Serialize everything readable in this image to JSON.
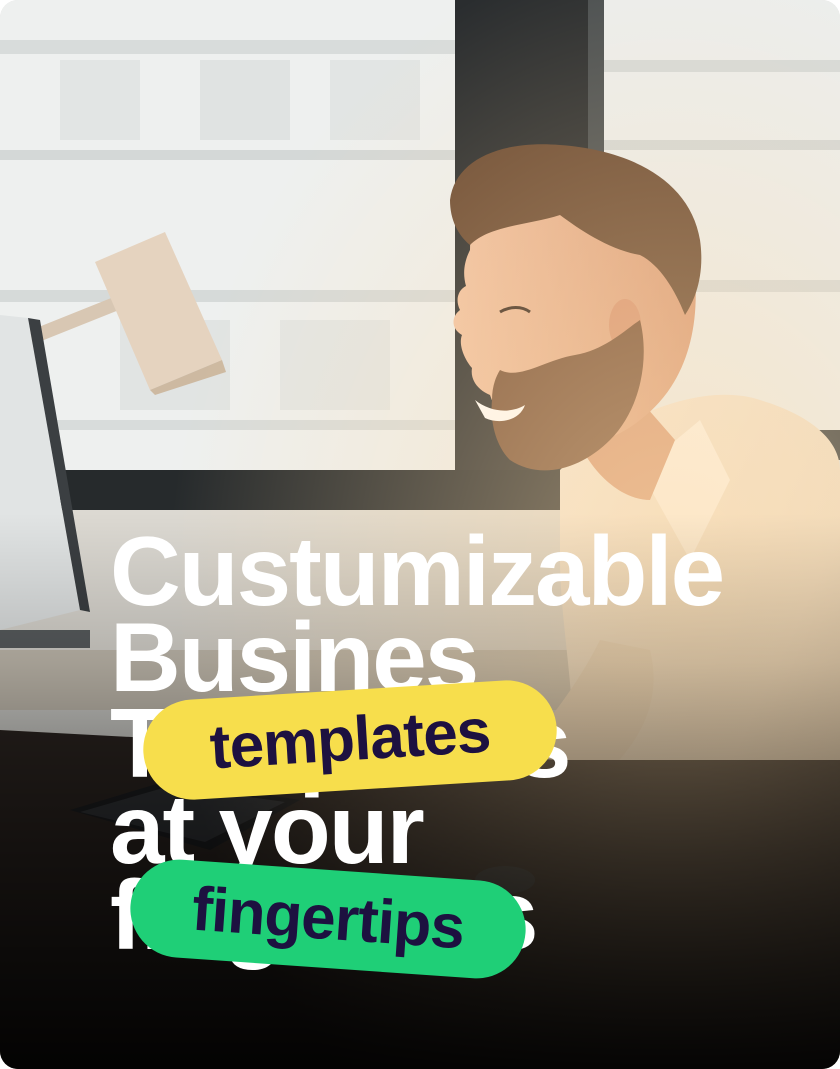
{
  "headline": {
    "line1": "Custumizable",
    "line2": "Busines",
    "line3": "Templates",
    "line4": "at your",
    "line5": "fingertips"
  },
  "stickers": {
    "templates": {
      "label": "templates",
      "color": "#f7de4c"
    },
    "fingertips": {
      "label": "fingertips",
      "color": "#1fcf77"
    }
  },
  "colors": {
    "headline_text": "#ffffff",
    "sticker_text": "#1d1140"
  },
  "image": {
    "subject": "smiling bearded man in white shirt working at a computer desk in a bright office with a desk lamp"
  }
}
